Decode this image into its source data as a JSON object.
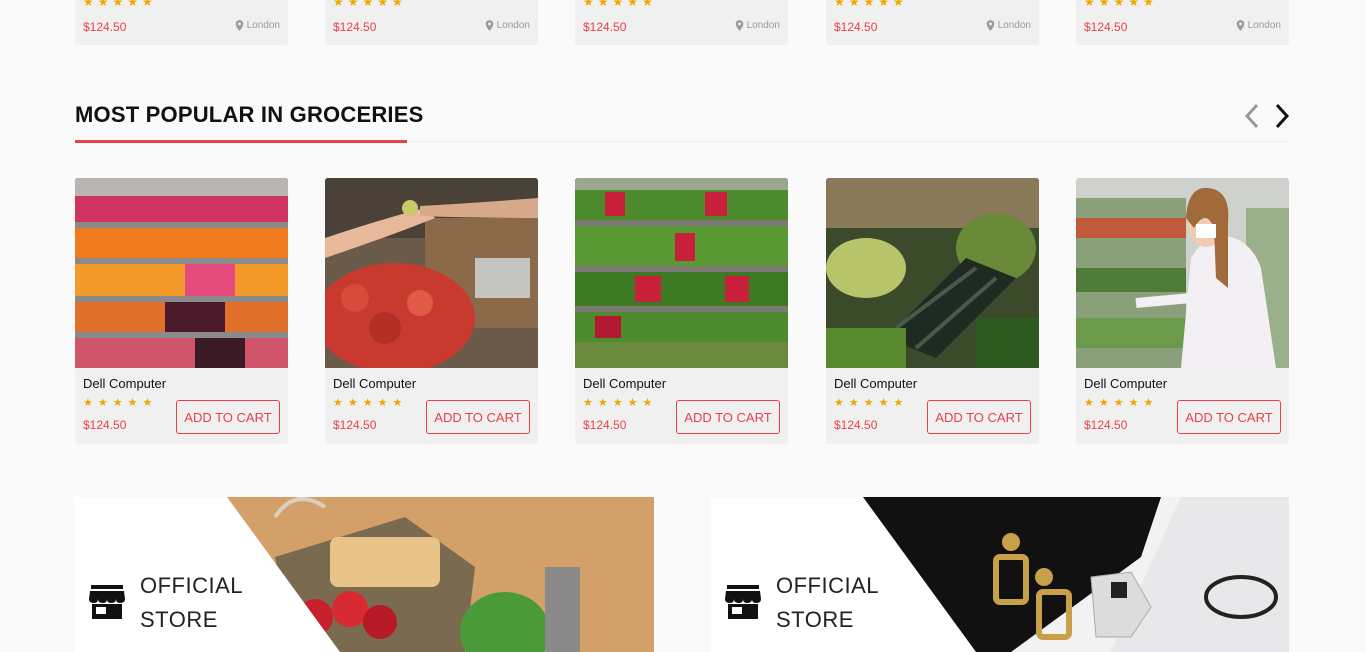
{
  "top_row": {
    "cards": [
      {
        "stars": "★★★★★",
        "price": "$124.50",
        "location": "London"
      },
      {
        "stars": "★★★★★",
        "price": "$124.50",
        "location": "London"
      },
      {
        "stars": "★★★★★",
        "price": "$124.50",
        "location": "London"
      },
      {
        "stars": "★★★★★",
        "price": "$124.50",
        "location": "London"
      },
      {
        "stars": "★★★★★",
        "price": "$124.50",
        "location": "London"
      }
    ],
    "location_icon": "map-pin-icon"
  },
  "section": {
    "title": "MOST POPULAR IN GROCERIES",
    "prev_icon": "chevron-left-icon",
    "next_icon": "chevron-right-icon",
    "accent_color": "#e8414c"
  },
  "products": [
    {
      "name": "Dell Computer",
      "stars": "★★★★★",
      "price": "$124.50",
      "button": "ADD TO CART",
      "image": "fruit-shelves"
    },
    {
      "name": "Dell Computer",
      "stars": "★★★★★",
      "price": "$124.50",
      "button": "ADD TO CART",
      "image": "market-hand-tomatoes"
    },
    {
      "name": "Dell Computer",
      "stars": "★★★★★",
      "price": "$124.50",
      "button": "ADD TO CART",
      "image": "vegetable-shelves"
    },
    {
      "name": "Dell Computer",
      "stars": "★★★★★",
      "price": "$124.50",
      "button": "ADD TO CART",
      "image": "kale-bunches"
    },
    {
      "name": "Dell Computer",
      "stars": "★★★★★",
      "price": "$124.50",
      "button": "ADD TO CART",
      "image": "woman-shopping"
    }
  ],
  "banners": [
    {
      "line1": "OFFICIAL",
      "line2": "STORE",
      "icon": "store-icon",
      "image": "grocery-bag"
    },
    {
      "line1": "OFFICIAL",
      "line2": "STORE",
      "icon": "store-icon",
      "image": "jewelry-accessories"
    }
  ],
  "colors": {
    "price": "#e8414c",
    "star": "#f0a500",
    "card_bg": "#f0f0f0"
  }
}
